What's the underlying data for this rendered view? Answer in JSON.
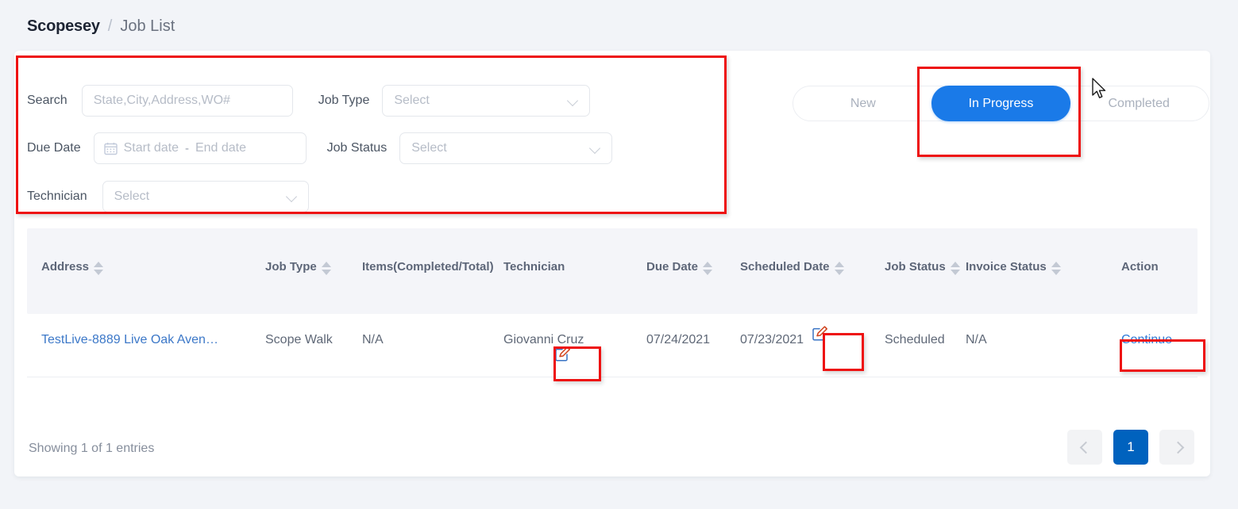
{
  "breadcrumb": {
    "app": "Scopesey",
    "separator": "/",
    "current": "Job List"
  },
  "filters": {
    "search_label": "Search",
    "search_value": "",
    "search_placeholder": "State,City,Address,WO#",
    "job_type_label": "Job Type",
    "job_type_value": "Select",
    "due_date_label": "Due Date",
    "start_date_placeholder": "Start date",
    "date_separator": "-",
    "end_date_placeholder": "End date",
    "job_status_label": "Job Status",
    "job_status_value": "Select",
    "technician_label": "Technician",
    "technician_value": "Select",
    "calendar_icon": "calendar-icon",
    "chevron_icon": "chevron-down-icon"
  },
  "tabs": {
    "active_color": "#1a7ae8",
    "items": [
      {
        "label": "New",
        "active": false
      },
      {
        "label": "In Progress",
        "active": true
      },
      {
        "label": "Completed",
        "active": false
      }
    ]
  },
  "table": {
    "columns": [
      {
        "label": "Address",
        "sortable": true
      },
      {
        "label": "Job Type",
        "sortable": true
      },
      {
        "label": "Items(Completed/Total)",
        "sortable": false
      },
      {
        "label": "Technician",
        "sortable": false
      },
      {
        "label": "Due Date",
        "sortable": true
      },
      {
        "label": "Scheduled Date",
        "sortable": true
      },
      {
        "label": "Job Status",
        "sortable": true
      },
      {
        "label": "Invoice Status",
        "sortable": true
      },
      {
        "label": "Action",
        "sortable": false
      }
    ],
    "rows": [
      {
        "address": "TestLive-8889 Live Oak Aven…",
        "job_type": "Scope Walk",
        "items": "N/A",
        "technician": "Giovanni Cruz",
        "technician_edit_icon": "edit-pencil-icon",
        "due_date": "07/24/2021",
        "scheduled_date": "07/23/2021",
        "scheduled_edit_icon": "edit-pencil-icon",
        "job_status": "Scheduled",
        "invoice_status": "N/A",
        "action": "Continue"
      }
    ]
  },
  "footer": {
    "showing": "Showing 1 of 1 entries",
    "prev_icon": "chevron-left-icon",
    "next_icon": "chevron-right-icon",
    "pages": [
      "1"
    ],
    "current_page": "1",
    "active_color": "#0062be"
  },
  "annotations": {
    "highlight_color": "#ee1111",
    "boxes": [
      "filter-panel",
      "in-progress-tab",
      "technician-edit-button",
      "scheduled-date-edit-button",
      "continue-action-link"
    ]
  }
}
